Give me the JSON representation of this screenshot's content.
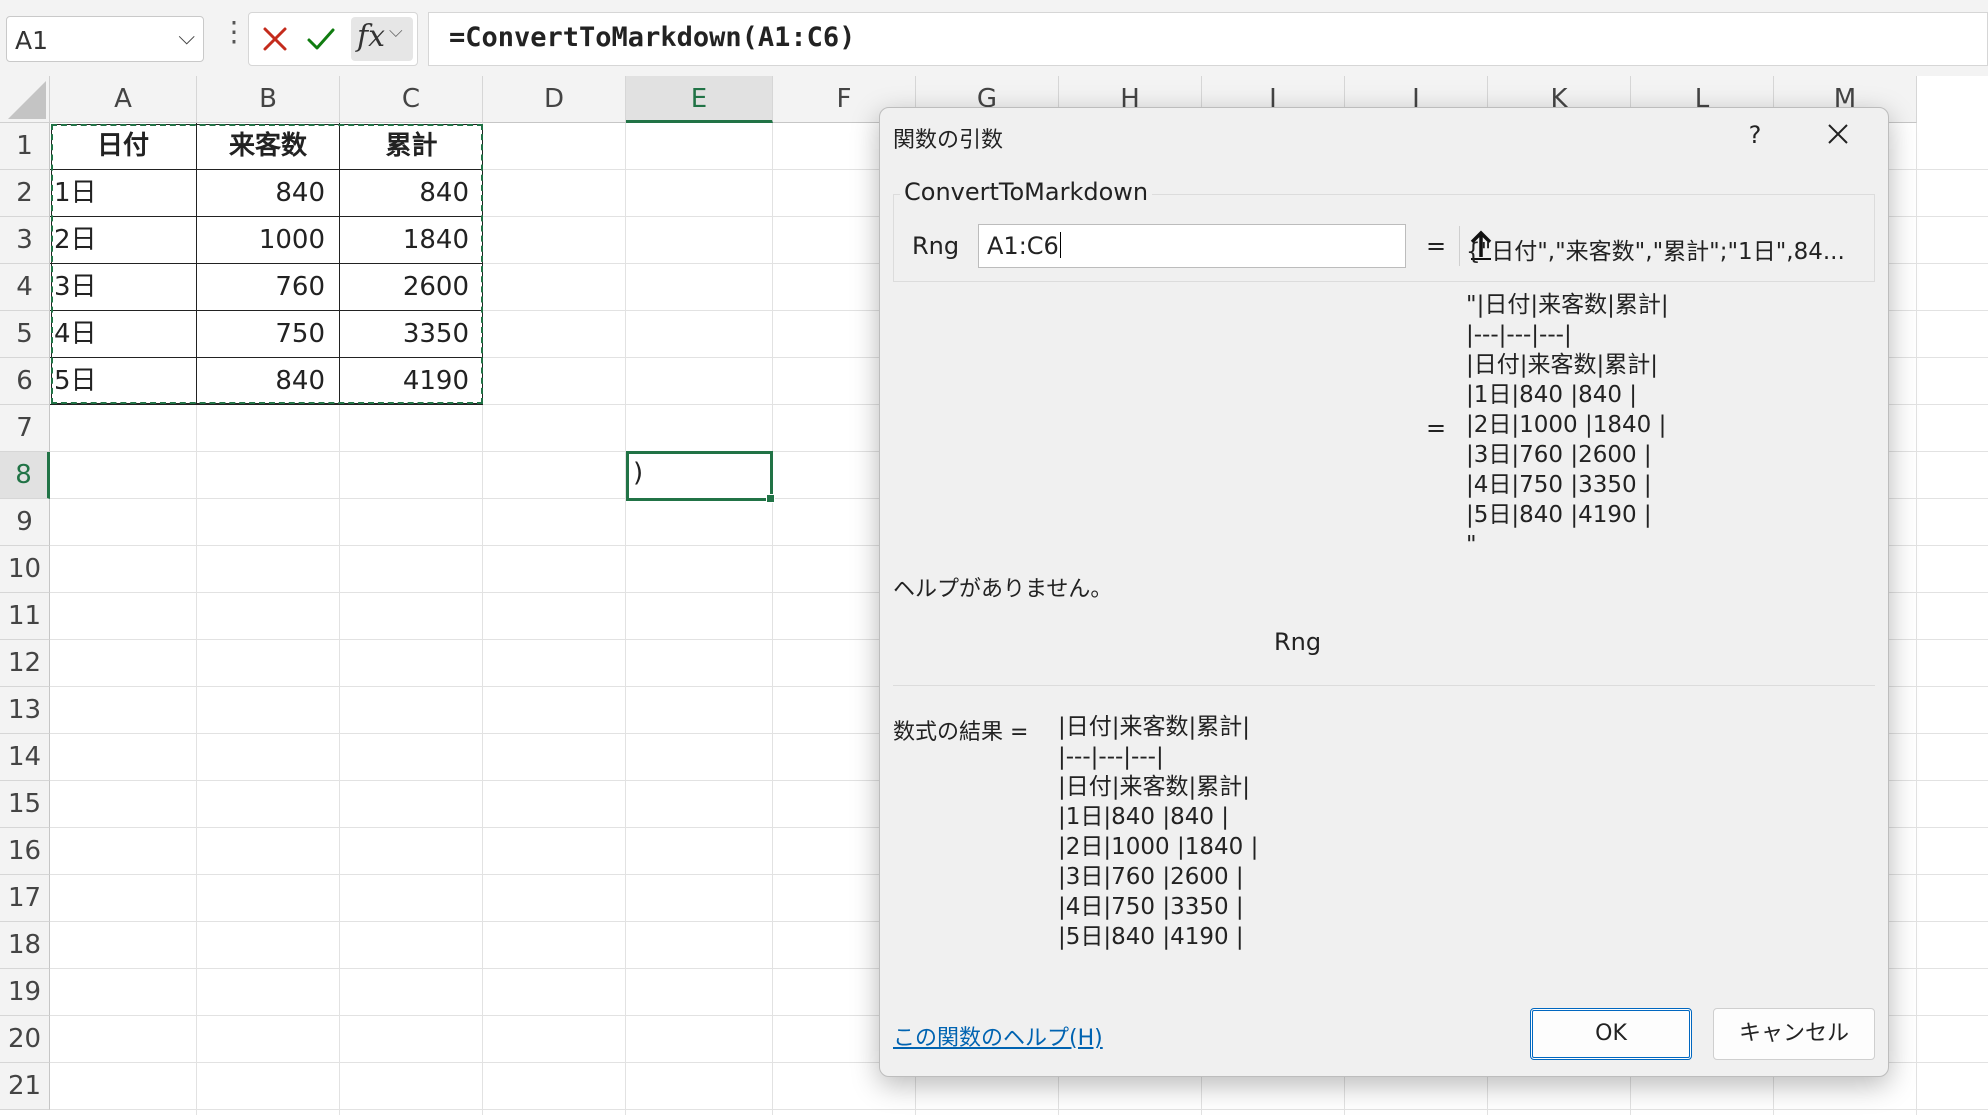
{
  "namebox": {
    "value": "A1"
  },
  "formula": {
    "text": "=ConvertToMarkdown(A1:C6)"
  },
  "columns": [
    "A",
    "B",
    "C",
    "D",
    "E",
    "F",
    "G",
    "H",
    "I",
    "J",
    "K",
    "L",
    "M"
  ],
  "rows": [
    "1",
    "2",
    "3",
    "4",
    "5",
    "6",
    "7",
    "8",
    "9",
    "10",
    "11",
    "12",
    "13",
    "14",
    "15",
    "16",
    "17",
    "18",
    "19",
    "20",
    "21"
  ],
  "selected_column": "E",
  "selected_row": "8",
  "table": {
    "headers": [
      "日付",
      "来客数",
      "累計"
    ],
    "data": [
      [
        "1日",
        "840",
        "840"
      ],
      [
        "2日",
        "1000",
        "1840"
      ],
      [
        "3日",
        "760",
        "2600"
      ],
      [
        "4日",
        "750",
        "3350"
      ],
      [
        "5日",
        "840",
        "4190"
      ]
    ]
  },
  "active_cell": {
    "content": ")"
  },
  "dialog": {
    "title": "関数の引数",
    "help_button": "?",
    "function_name": "ConvertToMarkdown",
    "arg_label": "Rng",
    "arg_value": "A1:C6",
    "arg_eval": "{\"日付\",\"来客数\",\"累計\";\"1日\",84...",
    "equals": "=",
    "return_lines": [
      "\"|日付|来客数|累計|",
      "|---|---|---|",
      "|日付|来客数|累計|",
      "|1日|840 |840 |",
      "|2日|1000 |1840 |",
      "|3日|760 |2600 |",
      "|4日|750 |3350 |",
      "|5日|840 |4190 |",
      "\""
    ],
    "description": "ヘルプがありません。",
    "arg_name_desc": "Rng",
    "result_label": "数式の結果 =",
    "result_lines": [
      "|日付|来客数|累計|",
      "|---|---|---|",
      "|日付|来客数|累計|",
      "|1日|840 |840 |",
      "|2日|1000 |1840 |",
      "|3日|760 |2600 |",
      "|4日|750 |3350 |",
      "|5日|840 |4190 |"
    ],
    "help_link": "この関数のヘルプ(H)",
    "ok_label": "OK",
    "cancel_label": "キャンセル"
  },
  "colors": {
    "accent": "#217346",
    "link": "#0063b1",
    "cancel_icon": "#c42b1c",
    "enter_icon": "#107c10"
  }
}
